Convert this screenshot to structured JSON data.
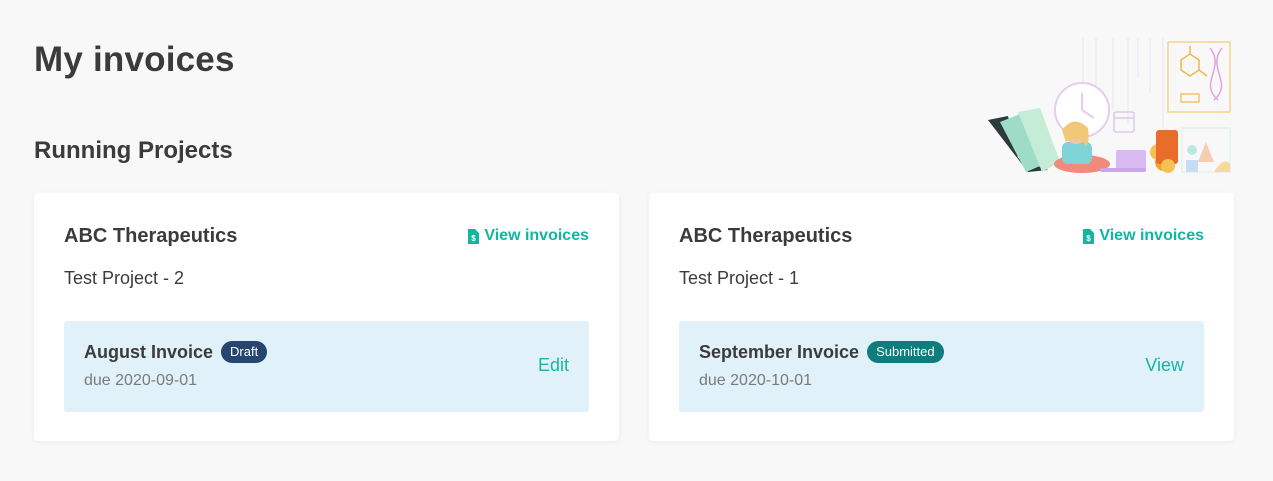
{
  "page": {
    "title": "My invoices",
    "section_title": "Running Projects"
  },
  "colors": {
    "accent": "#11b5a2",
    "draft_badge": "#27466f",
    "submitted_badge": "#0f7d7c",
    "invoice_box_bg": "#e0f1f9",
    "page_bg": "#f8f8f8"
  },
  "projects": [
    {
      "client": "ABC Therapeutics",
      "view_invoices_label": "View invoices",
      "view_invoices_icon": "invoice-file-icon",
      "project": "Test Project - 2",
      "invoice": {
        "title": "August Invoice",
        "status": "Draft",
        "due": "due 2020-09-01",
        "action": "Edit"
      }
    },
    {
      "client": "ABC Therapeutics",
      "view_invoices_label": "View invoices",
      "view_invoices_icon": "invoice-file-icon",
      "project": "Test Project - 1",
      "invoice": {
        "title": "September Invoice",
        "status": "Submitted",
        "due": "due 2020-10-01",
        "action": "View"
      }
    }
  ],
  "illustration": {
    "name": "person-with-laptop-illustration"
  }
}
